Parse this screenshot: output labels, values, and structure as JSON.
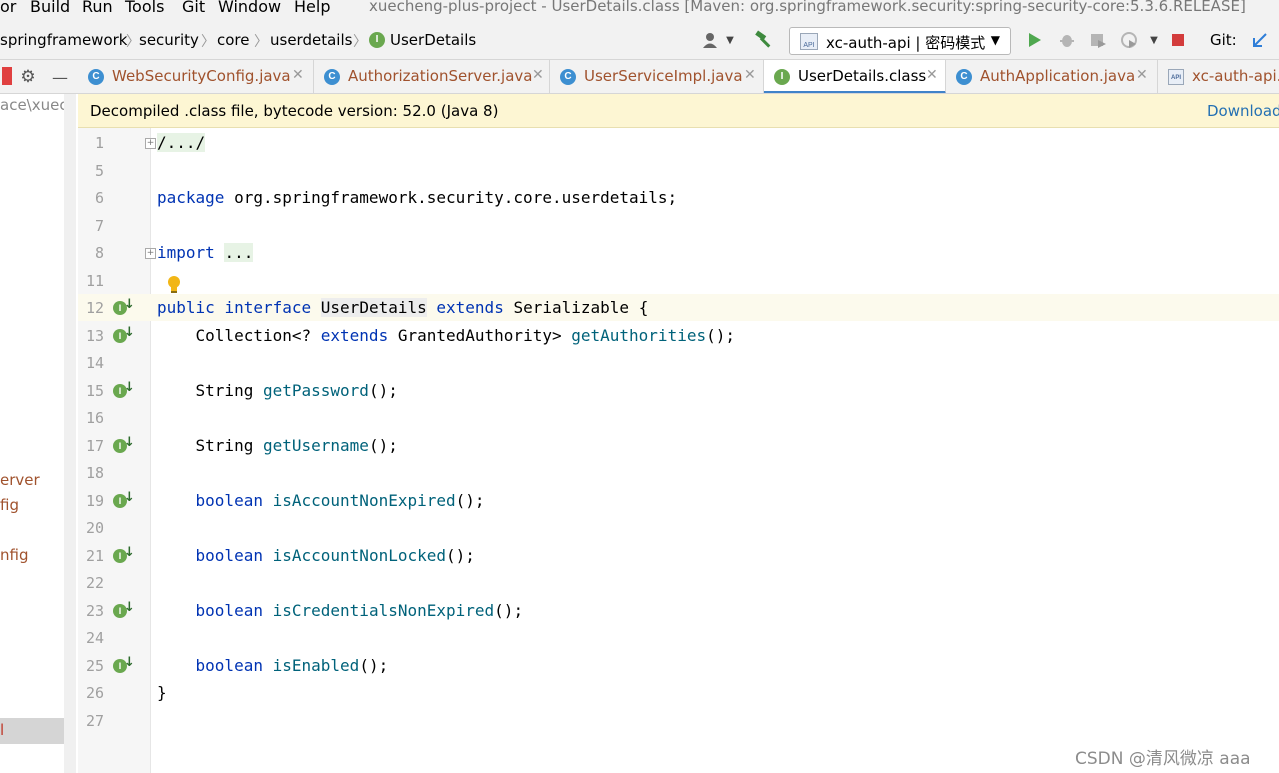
{
  "menu": [
    "or",
    "Build",
    "Run",
    "Tools",
    "Git",
    "Window",
    "Help"
  ],
  "window_title": "xuecheng-plus-project - UserDetails.class [Maven: org.springframework.security:spring-security-core:5.3.6.RELEASE]",
  "breadcrumb": [
    "springframework",
    "security",
    "core",
    "userdetails",
    "UserDetails"
  ],
  "run_config": "xc-auth-api | 密码模式",
  "git_label": "Git:",
  "tabs": [
    {
      "label": "WebSecurityConfig.java",
      "icon": "class-icon"
    },
    {
      "label": "AuthorizationServer.java",
      "icon": "class-icon"
    },
    {
      "label": "UserServiceImpl.java",
      "icon": "class-icon"
    },
    {
      "label": "UserDetails.class",
      "icon": "interface-icon",
      "active": true
    },
    {
      "label": "AuthApplication.java",
      "icon": "class-icon"
    },
    {
      "label": "xc-auth-api.",
      "icon": "api-icon"
    }
  ],
  "project_panel": {
    "path": "ace\\xueche",
    "items": [
      "erver",
      "fig",
      "nfig",
      "l"
    ]
  },
  "banner": {
    "text": "Decompiled .class file, bytecode version: 52.0 (Java 8)",
    "link": "Download"
  },
  "line_numbers": [
    "1",
    "5",
    "6",
    "7",
    "8",
    "11",
    "12",
    "13",
    "14",
    "15",
    "16",
    "17",
    "18",
    "19",
    "20",
    "21",
    "22",
    "23",
    "24",
    "25",
    "26",
    "27"
  ],
  "code": {
    "l1": "/.../",
    "pkg_kw": "package",
    "pkg_name": " org.springframework.security.core.userdetails;",
    "imp_kw": "import",
    "imp_rest": "...",
    "decl_public": "public",
    "decl_interface": "interface",
    "decl_name": "UserDetails",
    "decl_extends": "extends",
    "decl_rest": " Serializable {",
    "m1_type": "    Collection<? ",
    "m1_extends": "extends",
    "m1_mid": " GrantedAuthority> ",
    "m1_name": "getAuthorities",
    "m1_end": "();",
    "m2_type": "    String ",
    "m2_name": "getPassword",
    "m3_type": "    String ",
    "m3_name": "getUsername",
    "bool": "boolean",
    "m4_name": "isAccountNonExpired",
    "m5_name": "isAccountNonLocked",
    "m6_name": "isCredentialsNonExpired",
    "m7_name": "isEnabled",
    "paren": "();",
    "close": "}"
  },
  "watermark": "CSDN @清风微凉 aaa"
}
